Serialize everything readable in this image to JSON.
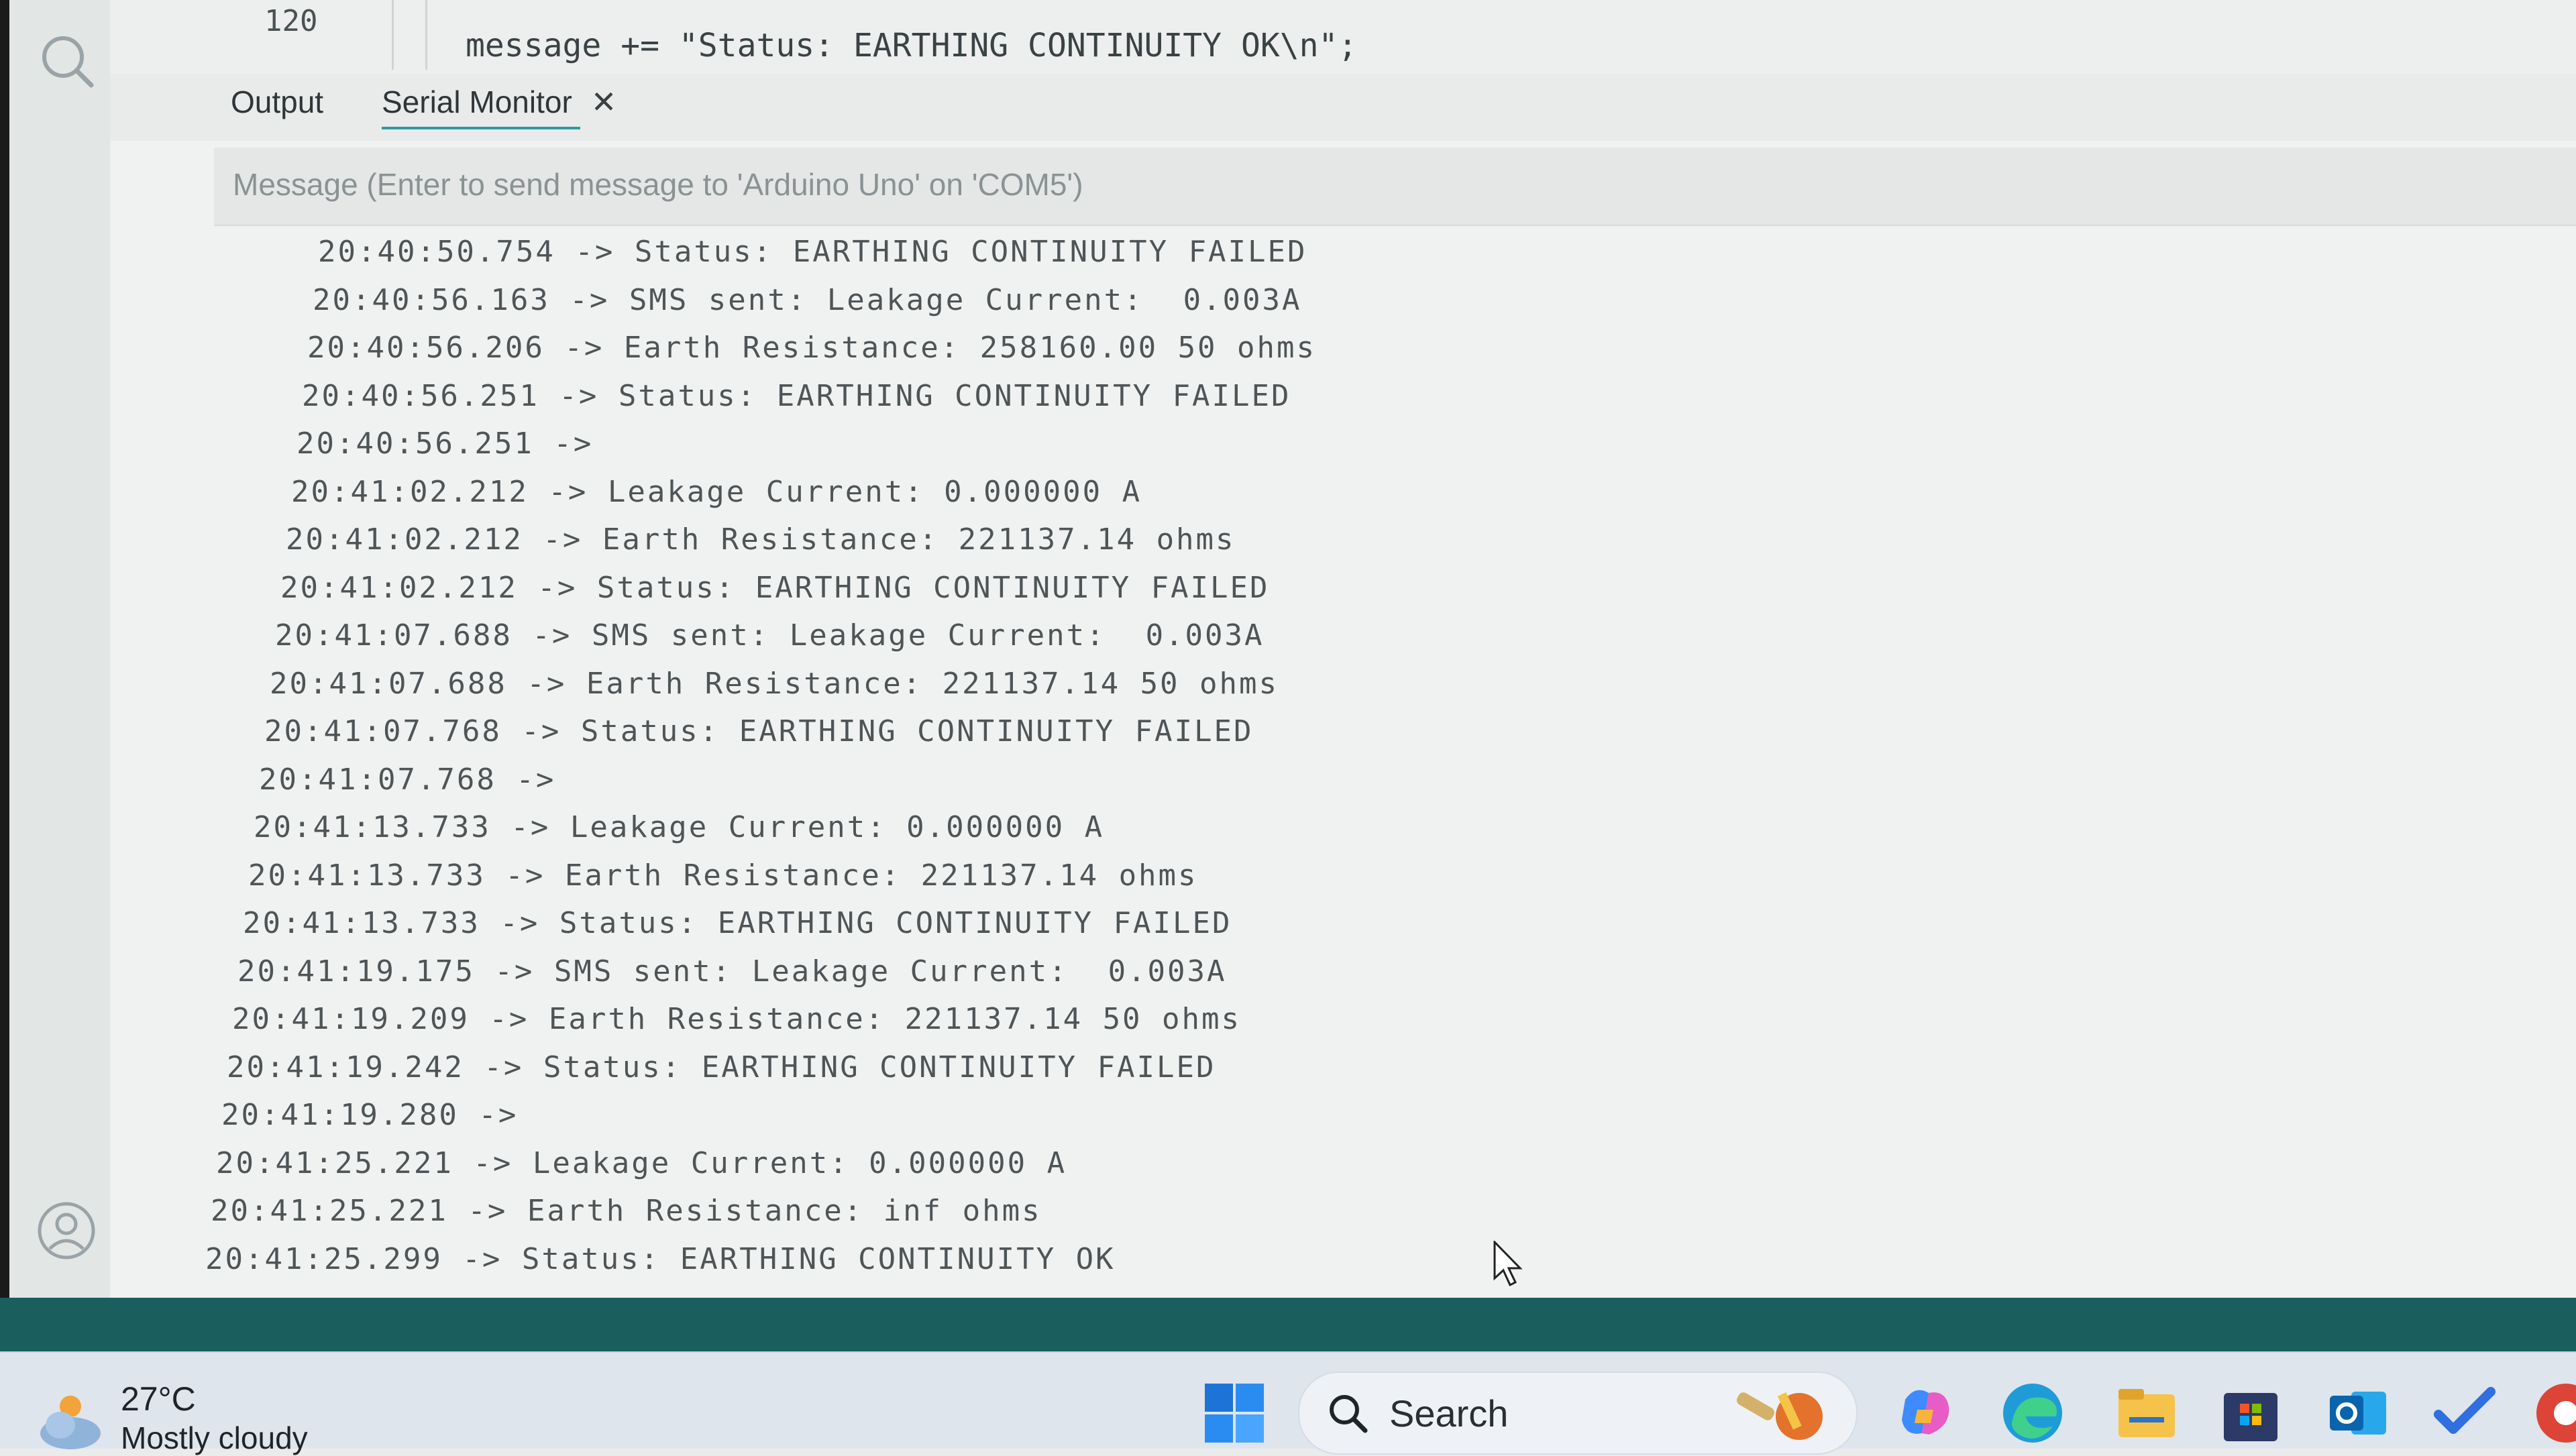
{
  "editor": {
    "line_number": "120",
    "code_line": "message += \"Status: EARTHING CONTINUITY OK\\n\";"
  },
  "panel": {
    "tabs": [
      {
        "label": "Output",
        "active": false
      },
      {
        "label": "Serial Monitor",
        "active": true,
        "closable": true
      }
    ],
    "message_placeholder": "Message (Enter to send message to 'Arduino Uno' on 'COM5')"
  },
  "serial_log": [
    "20:40:50.754 -> Status: EARTHING CONTINUITY FAILED",
    "20:40:56.163 -> SMS sent: Leakage Current:  0.003A",
    "20:40:56.206 -> Earth Resistance: 258160.00 50 ohms",
    "20:40:56.251 -> Status: EARTHING CONTINUITY FAILED",
    "20:40:56.251 ->",
    "20:41:02.212 -> Leakage Current: 0.000000 A",
    "20:41:02.212 -> Earth Resistance: 221137.14 ohms",
    "20:41:02.212 -> Status: EARTHING CONTINUITY FAILED",
    "20:41:07.688 -> SMS sent: Leakage Current:  0.003A",
    "20:41:07.688 -> Earth Resistance: 221137.14 50 ohms",
    "20:41:07.768 -> Status: EARTHING CONTINUITY FAILED",
    "20:41:07.768 ->",
    "20:41:13.733 -> Leakage Current: 0.000000 A",
    "20:41:13.733 -> Earth Resistance: 221137.14 ohms",
    "20:41:13.733 -> Status: EARTHING CONTINUITY FAILED",
    "20:41:19.175 -> SMS sent: Leakage Current:  0.003A",
    "20:41:19.209 -> Earth Resistance: 221137.14 50 ohms",
    "20:41:19.242 -> Status: EARTHING CONTINUITY FAILED",
    "20:41:19.280 ->",
    "20:41:25.221 -> Leakage Current: 0.000000 A",
    "20:41:25.221 -> Earth Resistance: inf ohms",
    "20:41:25.299 -> Status: EARTHING CONTINUITY OK"
  ],
  "taskbar": {
    "temperature": "27°C",
    "condition": "Mostly cloudy",
    "search_label": "Search",
    "icons": [
      "start-icon",
      "search-icon",
      "copilot-icon",
      "edge-icon",
      "file-explorer-icon",
      "store-icon",
      "outlook-icon",
      "todo-icon"
    ]
  },
  "colors": {
    "status_bar": "#1b5e5e",
    "tab_accent": "#2b9c9a",
    "panel_bg": "#f0f2f1"
  }
}
